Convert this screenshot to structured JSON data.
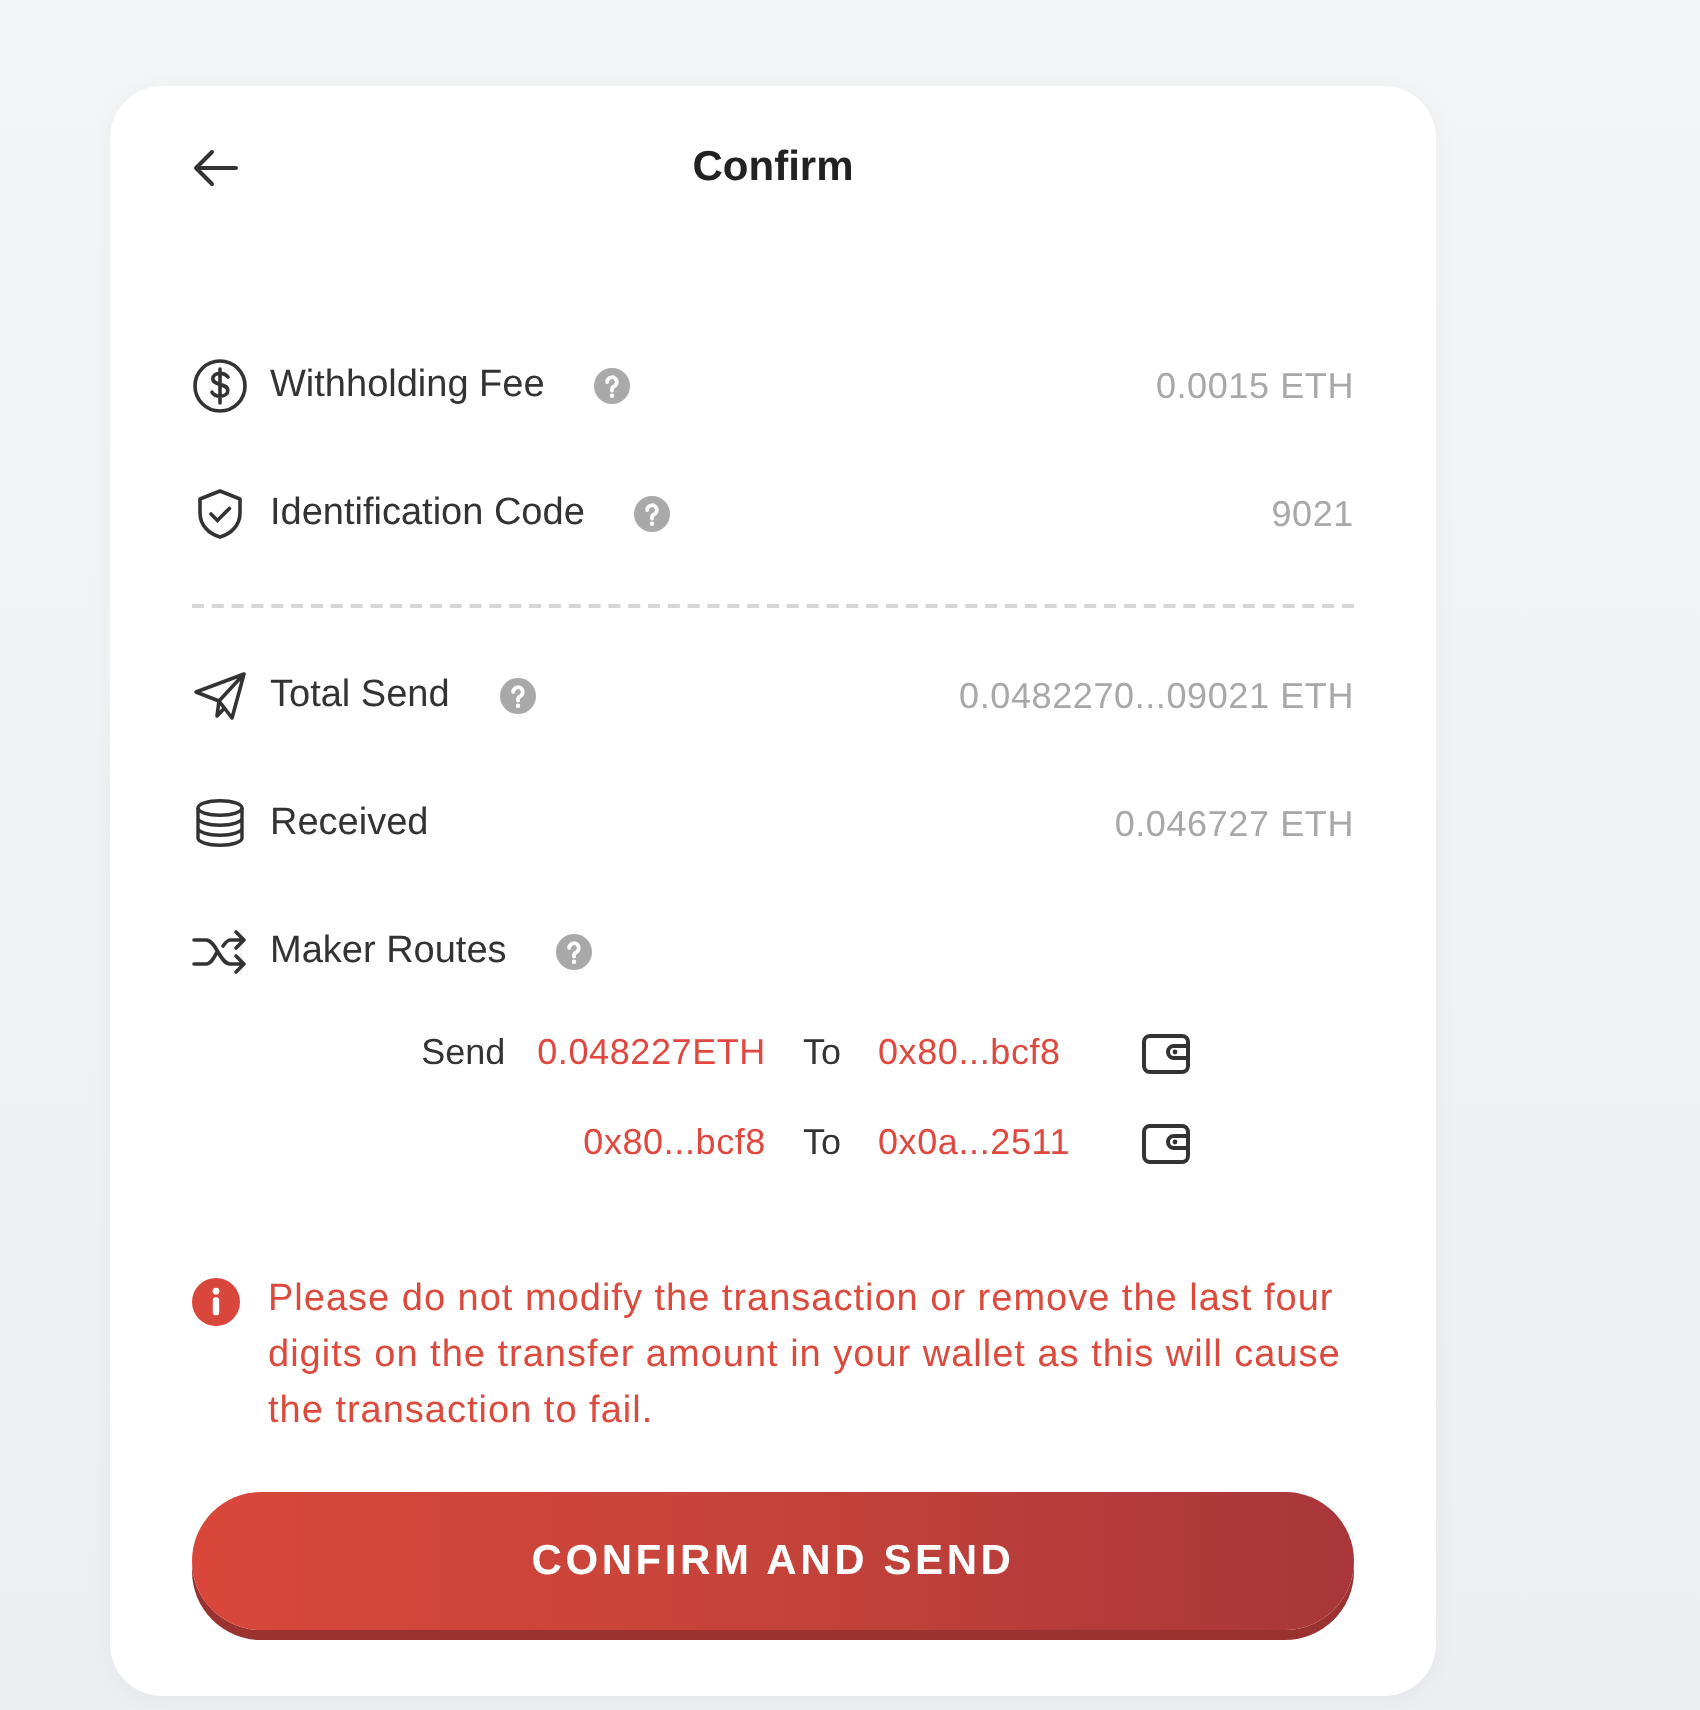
{
  "header": {
    "title": "Confirm"
  },
  "fee_rows": [
    {
      "label": "Withholding Fee",
      "help": true,
      "value": "0.0015 ETH"
    },
    {
      "label": "Identification Code",
      "help": true,
      "value": "9021"
    }
  ],
  "send_rows": [
    {
      "label": "Total Send",
      "help": true,
      "value": "0.0482270...09021 ETH"
    },
    {
      "label": "Received",
      "help": false,
      "value": "0.046727 ETH"
    },
    {
      "label": "Maker Routes",
      "help": true
    }
  ],
  "routes": [
    {
      "prefix": "Send",
      "source": "0.048227ETH",
      "connector": "To",
      "target": "0x80...bcf8"
    },
    {
      "source": "0x80...bcf8",
      "connector": "To",
      "target": "0x0a...2511"
    }
  ],
  "warning": "Please do not modify the transaction or remove the last four digits on the transfer amount in your wallet as this will cause the transaction to fail.",
  "confirm_button": "CONFIRM AND SEND"
}
